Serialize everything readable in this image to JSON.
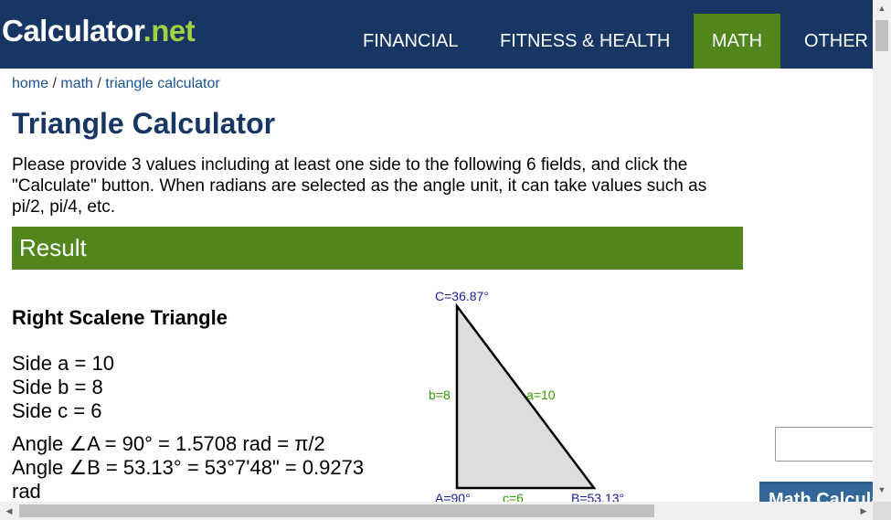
{
  "logo": {
    "text_main": "Calculator",
    "text_dot": ".",
    "text_tld": "net"
  },
  "nav": {
    "items": [
      "FINANCIAL",
      "FITNESS & HEALTH",
      "MATH",
      "OTHER"
    ]
  },
  "breadcrumb": {
    "home": "home",
    "sep1": " / ",
    "math": "math",
    "sep2": " / ",
    "current": "triangle calculator"
  },
  "page_title": "Triangle Calculator",
  "intro": "Please provide 3 values including at least one side to the following 6 fields, and click the \"Calculate\" button. When radians are selected as the angle unit, it can take values such as pi/2, pi/4, etc.",
  "result": {
    "heading": "Result",
    "triangle_type": "Right Scalene Triangle",
    "side_a": "Side a = 10",
    "side_b": "Side b = 8",
    "side_c": "Side c = 6",
    "angle_a": "Angle ∠A = 90° = 1.5708 rad = π/2",
    "angle_b_1": "Angle ∠B = 53.13° = 53°7'48\" = 0.9273",
    "angle_b_2": "rad"
  },
  "diagram": {
    "label_C": "C=36.87°",
    "label_b": "b=8",
    "label_a": "a=10",
    "label_A": "A=90°",
    "label_c": "c=6",
    "label_B": "B=53.13°",
    "fill_color": "#dddddd",
    "side_label_color": "#339900",
    "angle_label_color": "#1a1a99"
  },
  "sidebar": {
    "card_title": "Math Calculators"
  },
  "colors": {
    "header_bg": "#173664",
    "accent_green": "#51861d",
    "logo_green": "#9fd141",
    "link_blue": "#1a5490"
  }
}
